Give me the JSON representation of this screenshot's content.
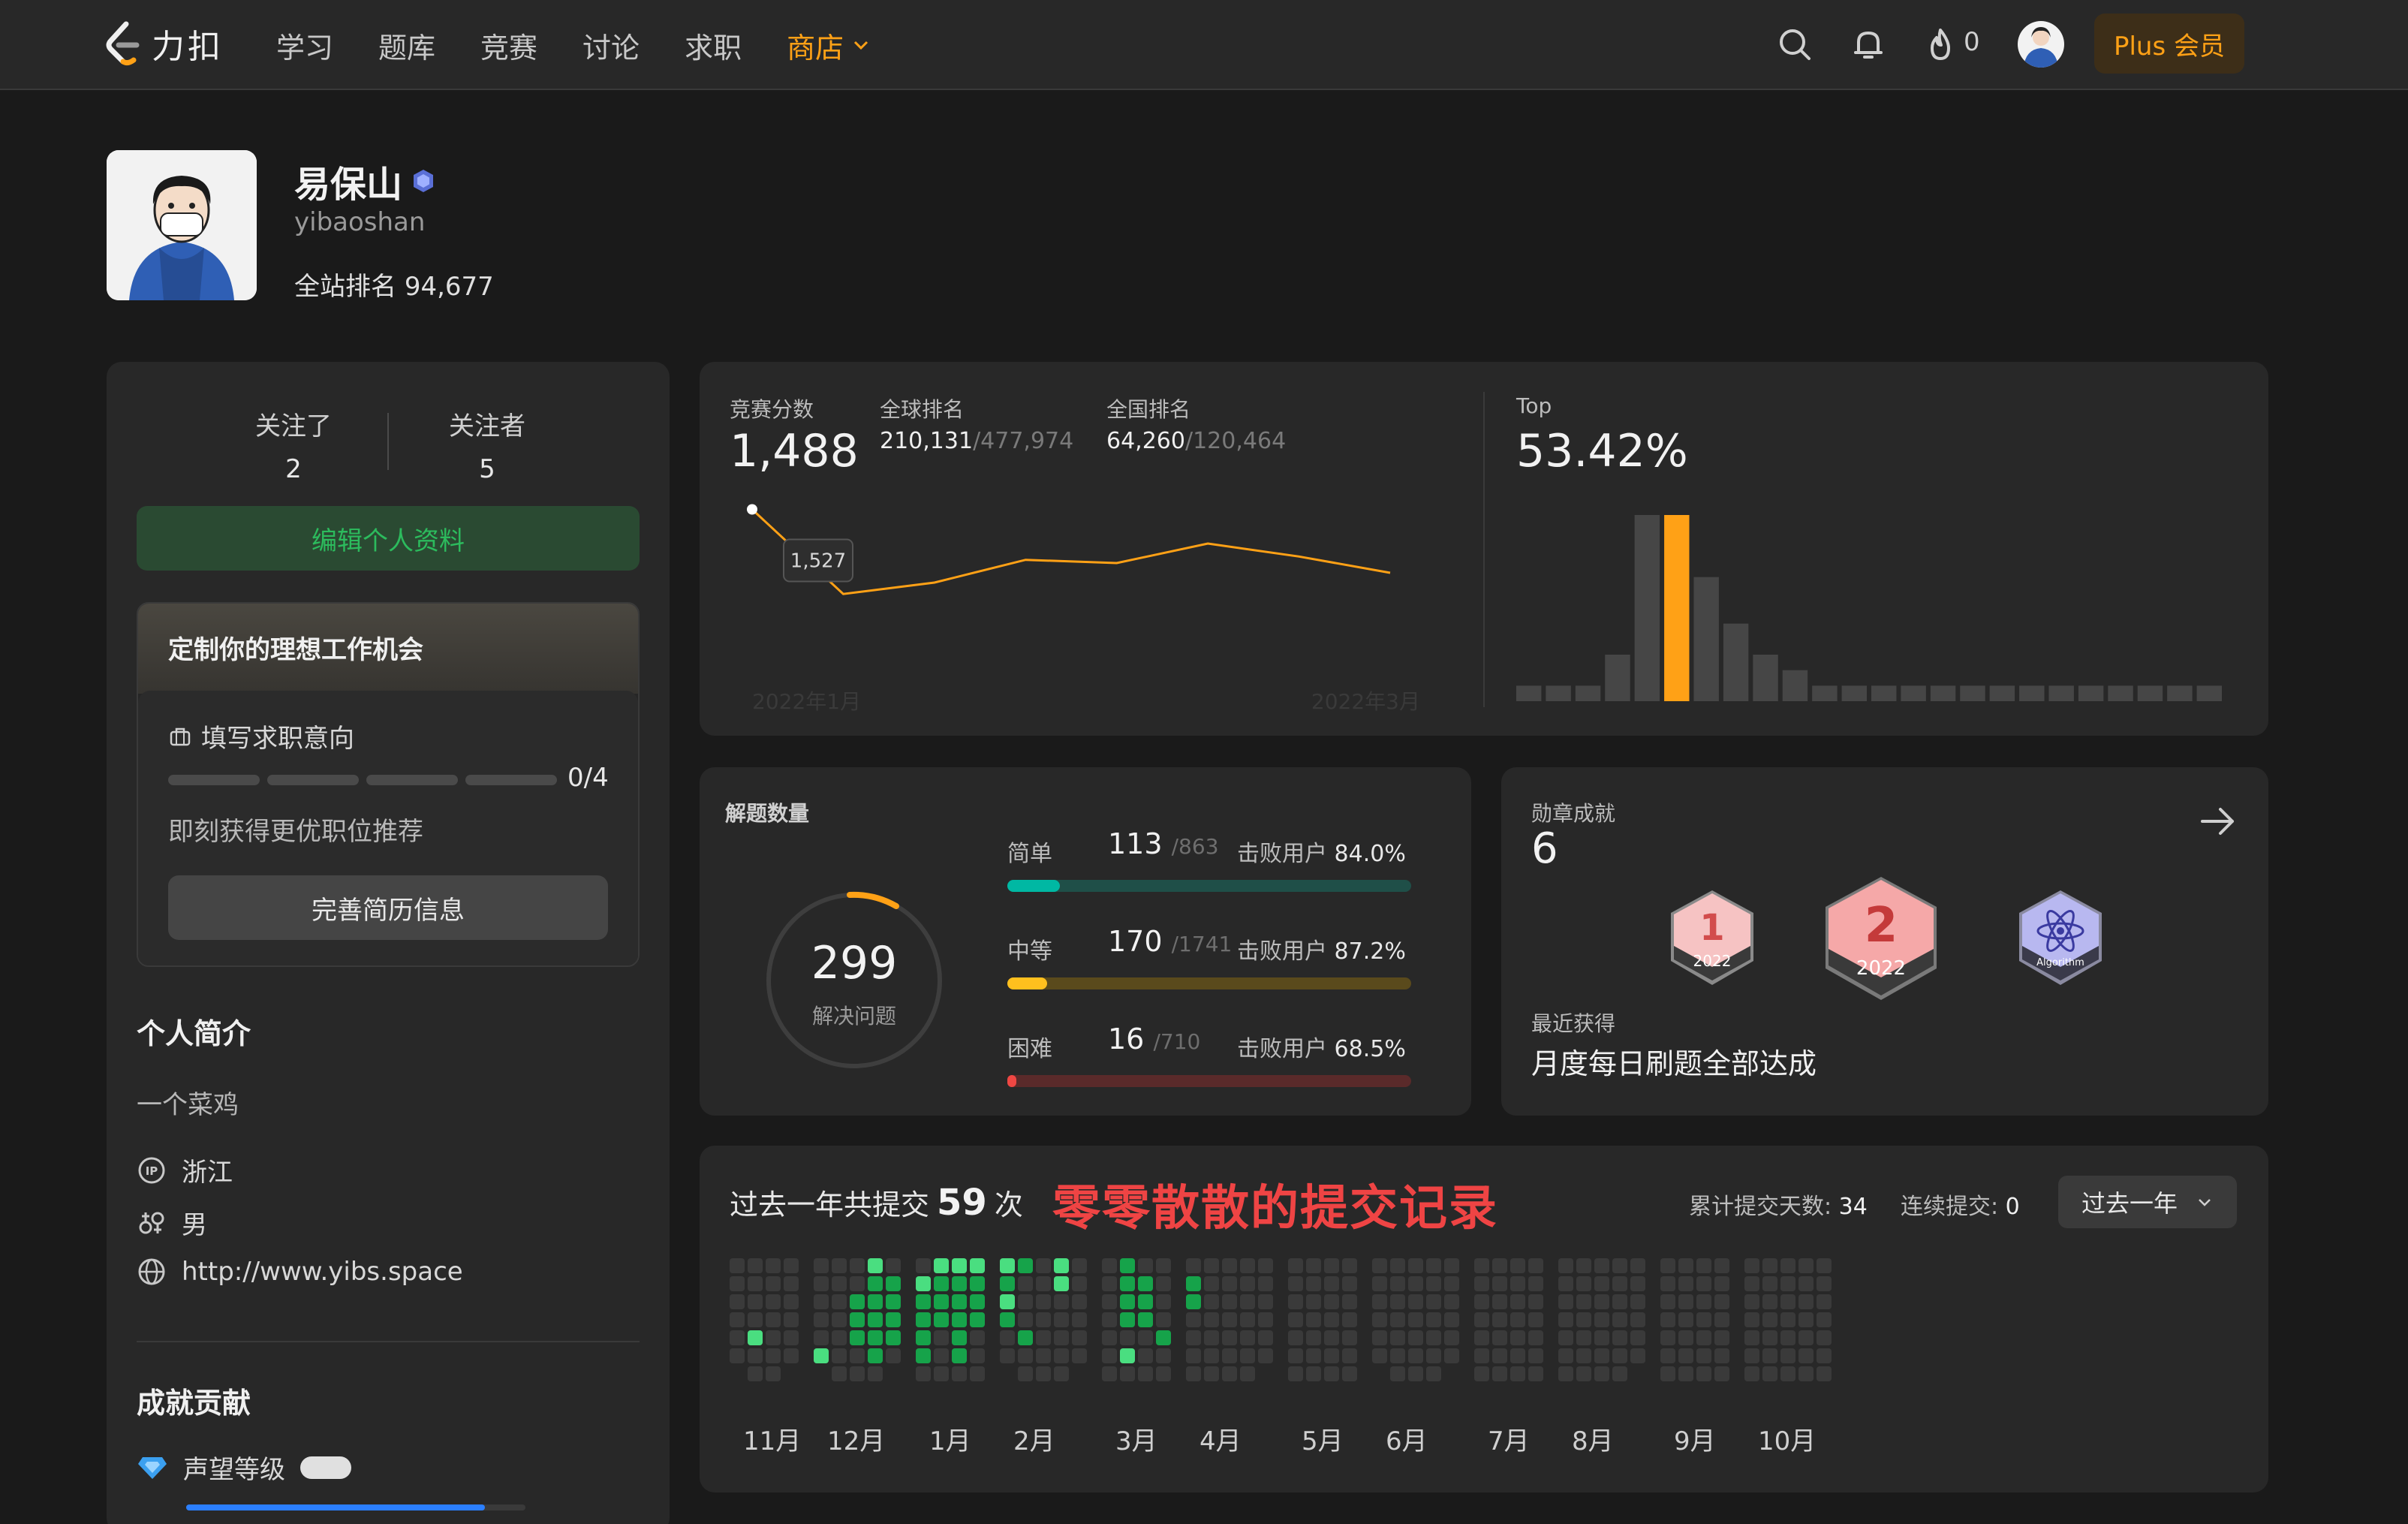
{
  "nav": {
    "logo_text": "力扣",
    "links": [
      "学习",
      "题库",
      "竞赛",
      "讨论",
      "求职"
    ],
    "store": "商店",
    "fire_count": "0",
    "plus": "Plus 会员"
  },
  "profile": {
    "name": "易保山",
    "username": "yibaoshan",
    "rank_label": "全站排名",
    "rank_value": "94,677"
  },
  "sidebar": {
    "following_label": "关注了",
    "following_count": "2",
    "followers_label": "关注者",
    "followers_count": "5",
    "edit_profile": "编辑个人资料",
    "job": {
      "title": "定制你的理想工作机会",
      "intent": "填写求职意向",
      "progress": "0/4",
      "progress_value": 0,
      "hint": "即刻获得更优职位推荐",
      "button": "完善简历信息"
    },
    "bio_title": "个人简介",
    "bio": "一个菜鸡",
    "location": "浙江",
    "gender": "男",
    "website": "http://www.yibs.space",
    "achievements_title": "成就贡献",
    "reputation_label": "声望等级",
    "reputation_progress": 0.88
  },
  "contest": {
    "score_label": "竞赛分数",
    "score": "1,488",
    "global_label": "全球排名",
    "global_rank": "210,131",
    "global_total": "/477,974",
    "national_label": "全国排名",
    "national_rank": "64,260",
    "national_total": "/120,464",
    "tooltip": "1,527",
    "start_label": "2022年1月",
    "end_label": "2022年3月",
    "top_label": "Top",
    "top_value": "53.42%"
  },
  "solved": {
    "title": "解题数量",
    "total": "299",
    "total_label": "解决问题",
    "beat_label": "击败用户",
    "items": [
      {
        "label": "简单",
        "solved": "113",
        "total": "/863",
        "beat": "84.0%",
        "fraction": 0.131
      },
      {
        "label": "中等",
        "solved": "170",
        "total": "/1741",
        "beat": "87.2%",
        "fraction": 0.098
      },
      {
        "label": "困难",
        "solved": "16",
        "total": "/710",
        "beat": "68.5%",
        "fraction": 0.023
      }
    ]
  },
  "badges": {
    "title": "勋章成就",
    "count": "6",
    "recent_label": "最近获得",
    "recent_name": "月度每日刷题全部达成",
    "badge1_num": "1",
    "badge1_year": "2022",
    "badge2_num": "2",
    "badge2_year": "2022",
    "badge3_text": "Algorithm"
  },
  "submissions": {
    "prefix": "过去一年共提交",
    "count": "59",
    "suffix": "次",
    "note": "零零散散的提交记录",
    "days_label": "累计提交天数:",
    "days": "34",
    "streak_label": "连续提交:",
    "streak": "0",
    "range": "过去一年",
    "months": [
      "11月",
      "12月",
      "1月",
      "2月",
      "3月",
      "4月",
      "5月",
      "6月",
      "7月",
      "8月",
      "9月",
      "10月"
    ]
  },
  "chart_data": [
    {
      "type": "line",
      "title": "",
      "x": [
        "2022年1月",
        "",
        "",
        "",
        "",
        "",
        "",
        "2022年3月"
      ],
      "series": [
        {
          "values": [
            1527,
            1475,
            1482,
            1496,
            1494,
            1506,
            1498,
            1488
          ]
        }
      ]
    },
    {
      "type": "bar",
      "title": "",
      "highlight_index": 5,
      "values": [
        1,
        1,
        1,
        3,
        12,
        12,
        8,
        5,
        3,
        2,
        1,
        1,
        1,
        1,
        1,
        1,
        1,
        1,
        1,
        1,
        1,
        1,
        1,
        1
      ]
    }
  ],
  "colors": {
    "accent": "#ffa116",
    "easy": "#00b8a3",
    "medium": "#ffc01e",
    "hard": "#ef4743",
    "green": "#2cbb5d"
  }
}
